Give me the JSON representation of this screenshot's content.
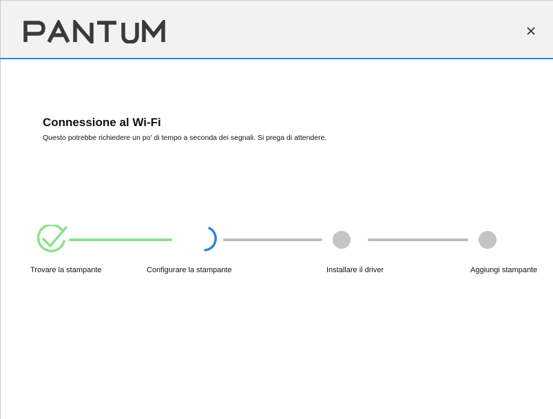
{
  "header": {
    "brand": "PANTUM",
    "close_label": "×"
  },
  "main": {
    "title": "Connessione al Wi-Fi",
    "subtitle": "Questo potrebbe richiedere un po' di tempo a seconda dei segnali. Si prega di attendere."
  },
  "steps": [
    {
      "label": "Trovare la stampante",
      "state": "complete"
    },
    {
      "label": "Configurare la stampante",
      "state": "in-progress"
    },
    {
      "label": "Installare il driver",
      "state": "pending"
    },
    {
      "label": "Aggiungi stampante",
      "state": "pending"
    }
  ],
  "colors": {
    "accent": "#2b85d8",
    "complete": "#8fe08f",
    "pending": "#c4c4c4",
    "brand": "#3a3a3a"
  },
  "icons": {
    "close": "close-icon",
    "step_complete": "check-circle-icon",
    "step_in_progress": "spinner-icon",
    "step_pending": "pending-dot-icon"
  }
}
